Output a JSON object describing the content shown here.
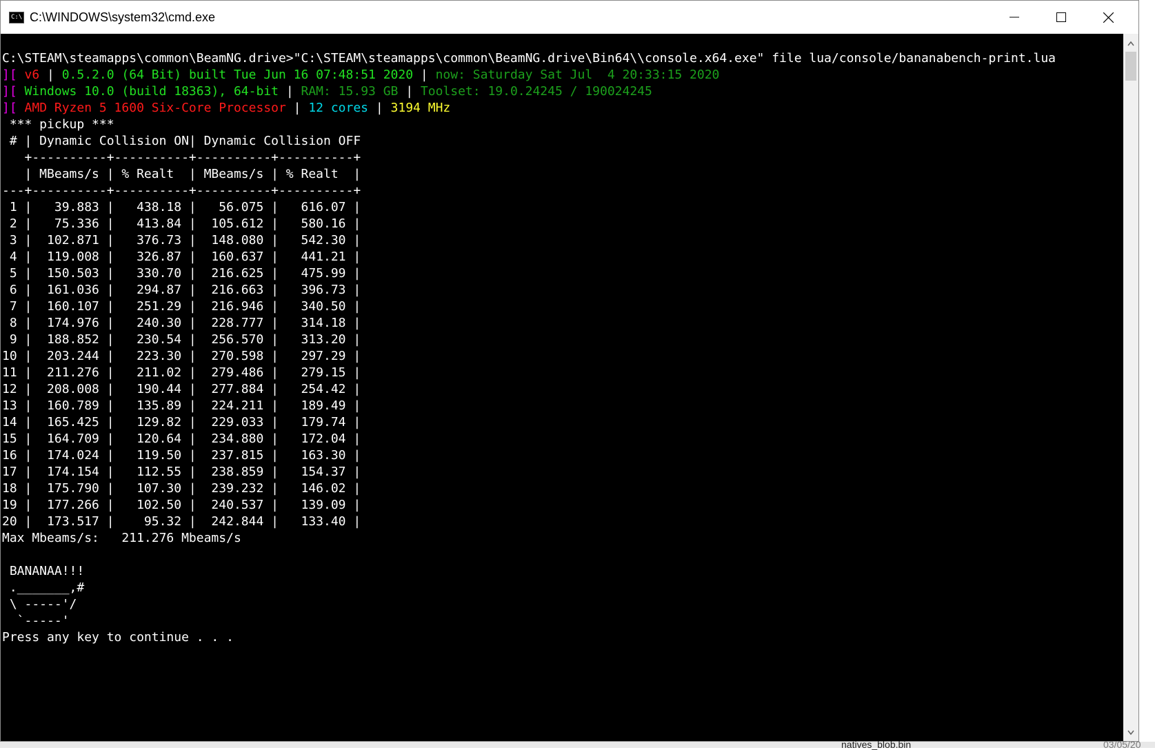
{
  "window": {
    "title": "C:\\WINDOWS\\system32\\cmd.exe",
    "icon_label": "C:\\",
    "controls": [
      "minimize-icon",
      "maximize-icon",
      "close-icon"
    ]
  },
  "colors": {
    "white": "#ffffff",
    "magenta": "#e600e6",
    "red": "#ff1a1a",
    "green": "#22e022",
    "dark_green": "#1ca01c",
    "cyan": "#00d8e8",
    "yellow": "#ffff30"
  },
  "console": {
    "lines": [
      [
        {
          "t": "C:\\STEAM\\steamapps\\common\\BeamNG.drive>\"C:\\STEAM\\steamapps\\common\\BeamNG.drive\\Bin64\\\\console.x64.exe\" file lua/console/bananabench-print.lua",
          "c": "white"
        }
      ],
      [
        {
          "t": "][ ",
          "c": "magenta"
        },
        {
          "t": "v6",
          "c": "red"
        },
        {
          "t": " | ",
          "c": "white"
        },
        {
          "t": "0.5.2.0 (64 Bit) built Tue Jun 16 07:48:51 2020",
          "c": "green"
        },
        {
          "t": " | ",
          "c": "white"
        },
        {
          "t": "now: Saturday Sat Jul  4 20:33:15 2020",
          "c": "dark_green"
        }
      ],
      [
        {
          "t": "][ ",
          "c": "magenta"
        },
        {
          "t": "Windows 10.0 (build 18363), 64-bit",
          "c": "green"
        },
        {
          "t": " | ",
          "c": "white"
        },
        {
          "t": "RAM: 15.93 GB",
          "c": "dark_green"
        },
        {
          "t": " | ",
          "c": "white"
        },
        {
          "t": "Toolset: 19.0.24245 / 190024245",
          "c": "dark_green"
        }
      ],
      [
        {
          "t": "][ ",
          "c": "magenta"
        },
        {
          "t": "AMD Ryzen 5 1600 Six-Core Processor",
          "c": "red"
        },
        {
          "t": " | ",
          "c": "white"
        },
        {
          "t": "12 cores",
          "c": "cyan"
        },
        {
          "t": " | ",
          "c": "white"
        },
        {
          "t": "3194 MHz",
          "c": "yellow"
        }
      ],
      [
        {
          "t": " *** pickup ***",
          "c": "white"
        }
      ],
      [
        {
          "t": " # | Dynamic Collision ON| Dynamic Collision OFF",
          "c": "white"
        }
      ],
      [
        {
          "t": "   +----------+----------+----------+----------+",
          "c": "white"
        }
      ],
      [
        {
          "t": "   | MBeams/s | % Realt  | MBeams/s | % Realt  |",
          "c": "white"
        }
      ],
      [
        {
          "t": "---+----------+----------+----------+----------+",
          "c": "white"
        }
      ],
      [
        {
          "t": " 1 |   39.883 |   438.18 |   56.075 |   616.07 |",
          "c": "white"
        }
      ],
      [
        {
          "t": " 2 |   75.336 |   413.84 |  105.612 |   580.16 |",
          "c": "white"
        }
      ],
      [
        {
          "t": " 3 |  102.871 |   376.73 |  148.080 |   542.30 |",
          "c": "white"
        }
      ],
      [
        {
          "t": " 4 |  119.008 |   326.87 |  160.637 |   441.21 |",
          "c": "white"
        }
      ],
      [
        {
          "t": " 5 |  150.503 |   330.70 |  216.625 |   475.99 |",
          "c": "white"
        }
      ],
      [
        {
          "t": " 6 |  161.036 |   294.87 |  216.663 |   396.73 |",
          "c": "white"
        }
      ],
      [
        {
          "t": " 7 |  160.107 |   251.29 |  216.946 |   340.50 |",
          "c": "white"
        }
      ],
      [
        {
          "t": " 8 |  174.976 |   240.30 |  228.777 |   314.18 |",
          "c": "white"
        }
      ],
      [
        {
          "t": " 9 |  188.852 |   230.54 |  256.570 |   313.20 |",
          "c": "white"
        }
      ],
      [
        {
          "t": "10 |  203.244 |   223.30 |  270.598 |   297.29 |",
          "c": "white"
        }
      ],
      [
        {
          "t": "11 |  211.276 |   211.02 |  279.486 |   279.15 |",
          "c": "white"
        }
      ],
      [
        {
          "t": "12 |  208.008 |   190.44 |  277.884 |   254.42 |",
          "c": "white"
        }
      ],
      [
        {
          "t": "13 |  160.789 |   135.89 |  224.211 |   189.49 |",
          "c": "white"
        }
      ],
      [
        {
          "t": "14 |  165.425 |   129.82 |  229.033 |   179.74 |",
          "c": "white"
        }
      ],
      [
        {
          "t": "15 |  164.709 |   120.64 |  234.880 |   172.04 |",
          "c": "white"
        }
      ],
      [
        {
          "t": "16 |  174.024 |   119.50 |  237.815 |   163.30 |",
          "c": "white"
        }
      ],
      [
        {
          "t": "17 |  174.154 |   112.55 |  238.859 |   154.37 |",
          "c": "white"
        }
      ],
      [
        {
          "t": "18 |  175.790 |   107.30 |  239.232 |   146.02 |",
          "c": "white"
        }
      ],
      [
        {
          "t": "19 |  177.266 |   102.50 |  240.537 |   139.09 |",
          "c": "white"
        }
      ],
      [
        {
          "t": "20 |  173.517 |    95.32 |  242.844 |   133.40 |",
          "c": "white"
        }
      ],
      [
        {
          "t": "Max Mbeams/s:   211.276 Mbeams/s",
          "c": "white"
        }
      ],
      [
        {
          "t": "",
          "c": "white"
        }
      ],
      [
        {
          "t": " BANANAA!!!",
          "c": "white"
        }
      ],
      [
        {
          "t": " ._______,#",
          "c": "white"
        }
      ],
      [
        {
          "t": " \\ -----'/",
          "c": "white"
        }
      ],
      [
        {
          "t": "  `-----'",
          "c": "white"
        }
      ],
      [
        {
          "t": "Press any key to continue . . .",
          "c": "white"
        }
      ]
    ]
  },
  "background": {
    "file_name": "natives_blob.bin",
    "date_fragment": "03/05/20"
  }
}
